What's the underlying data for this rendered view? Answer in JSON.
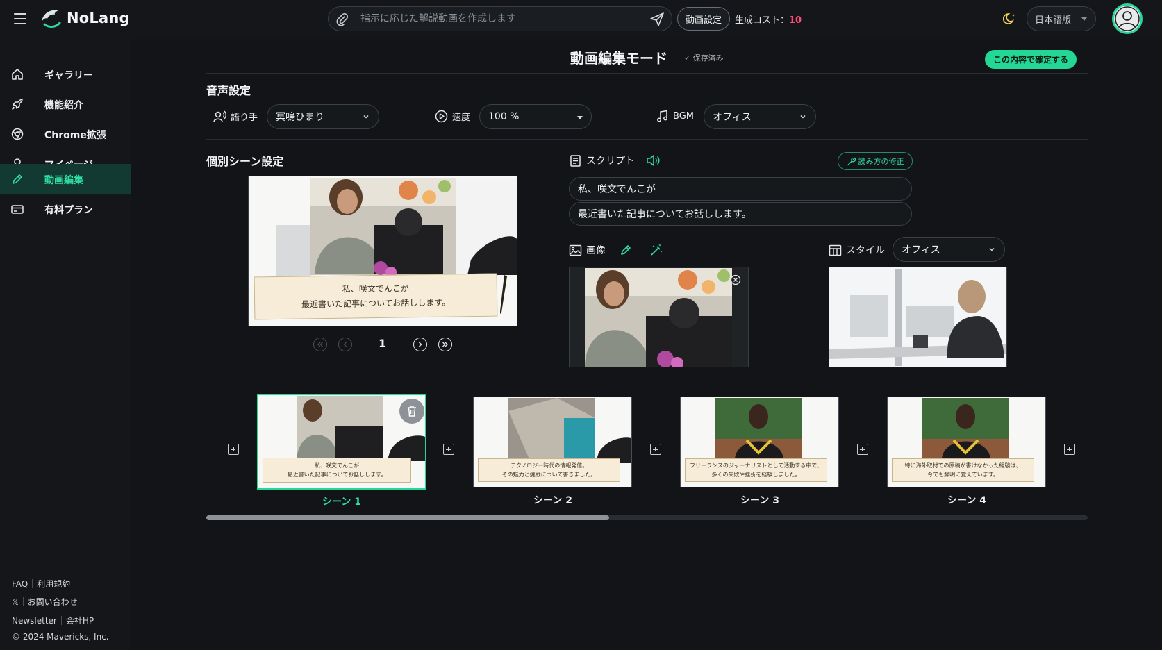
{
  "header": {
    "brand": "NoLang",
    "prompt_placeholder": "指示に応じた解説動画を作成します",
    "settings_label": "動画設定",
    "cost_label": "生成コスト：",
    "cost_value": "10",
    "language": "日本語版"
  },
  "sidebar": {
    "items": [
      {
        "label": "ギャラリー",
        "icon": "home-icon"
      },
      {
        "label": "機能紹介",
        "icon": "rocket-icon"
      },
      {
        "label": "Chrome拡張",
        "icon": "chrome-icon"
      },
      {
        "label": "マイページ",
        "icon": "user-icon"
      },
      {
        "label": "動画編集",
        "icon": "pencil-icon",
        "active": true
      },
      {
        "label": "有料プラン",
        "icon": "card-icon"
      }
    ],
    "footer": {
      "faq": "FAQ",
      "terms": "利用規約",
      "x": "𝕏",
      "contact": "お問い合わせ",
      "newsletter": "Newsletter",
      "company": "会社HP",
      "copyright": "© 2024 Mavericks, Inc."
    }
  },
  "main": {
    "title": "動画編集モード",
    "saved": "保存済み",
    "confirm_label": "この内容で確定する",
    "voice": {
      "section": "音声設定",
      "narrator_label": "語り手",
      "narrator_value": "冥鳴ひまり",
      "speed_label": "速度",
      "speed_value": "100 %",
      "bgm_label": "BGM",
      "bgm_value": "オフィス"
    },
    "scene": {
      "section": "個別シーン設定",
      "caption_line1": "私、咲文でんこが",
      "caption_line2": "最近書いた記事についてお話しします。",
      "page": "1"
    },
    "script": {
      "label": "スクリプト",
      "yomi_label": "読み方の修正",
      "lines": [
        "私、咲文でんこが",
        "最近書いた記事についてお話しします。"
      ]
    },
    "image": {
      "label": "画像"
    },
    "style": {
      "label": "スタイル",
      "value": "オフィス"
    },
    "timeline": [
      {
        "label": "シーン 1",
        "caption1": "私、咲文でんこが",
        "caption2": "最近書いた記事についてお話しします。"
      },
      {
        "label": "シーン 2",
        "caption1": "テクノロジー時代の情報発信。",
        "caption2": "その魅力と挑戦について書きました。"
      },
      {
        "label": "シーン 3",
        "caption1": "フリーランスのジャーナリストとして活動する中で、",
        "caption2": "多くの失敗や挫折を経験しました。"
      },
      {
        "label": "シーン 4",
        "caption1": "特に海外取材での原稿が書けなかった経験は、",
        "caption2": "今でも鮮明に覚えています。"
      }
    ]
  },
  "colors": {
    "accent": "#23d795",
    "cost": "#ff4a7a",
    "background": "#121417"
  }
}
